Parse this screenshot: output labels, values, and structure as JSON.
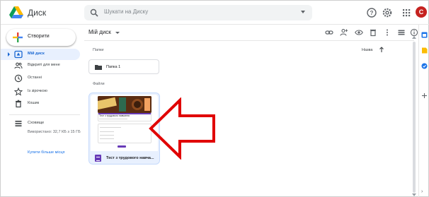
{
  "app": {
    "title": "Диск",
    "logo_icon": "google-drive-logo",
    "colors": {
      "accent": "#1a73e8",
      "active_bg": "#e8f0fe",
      "avatar": "#c5221f",
      "annotation": "#e00000"
    }
  },
  "search": {
    "placeholder": "Шукати на Диску",
    "icon": "search-icon"
  },
  "header": {
    "icons": [
      "support-icon",
      "settings-icon",
      "apps-grid-icon"
    ],
    "avatar_letter": "C"
  },
  "sidebar": {
    "create_label": "Створити",
    "items": [
      {
        "label": "Мій диск",
        "icon": "my-drive-icon",
        "active": true
      },
      {
        "label": "Відкриті для мене",
        "icon": "shared-people-icon",
        "active": false
      },
      {
        "label": "Останні",
        "icon": "clock-icon",
        "active": false
      },
      {
        "label": "Із зірочкою",
        "icon": "star-icon",
        "active": false
      },
      {
        "label": "Кошик",
        "icon": "trash-icon",
        "active": false
      }
    ],
    "storage": {
      "label": "Сховище",
      "icon": "storage-icon",
      "usage": "Використано: 32,7 КБ з 15 ГБ"
    },
    "buy_storage": "Купити більше місця"
  },
  "main": {
    "breadcrumb": "Мій диск",
    "toolbar_icons": [
      "link-icon",
      "add-person-icon",
      "preview-eye-icon",
      "delete-icon",
      "more-vert-icon",
      "list-view-icon",
      "info-icon"
    ],
    "folders_label": "Папки",
    "files_label": "Файли",
    "sort": {
      "label": "Назва",
      "direction": "up-arrow-icon"
    },
    "folders": [
      {
        "name": "Папка 1"
      }
    ],
    "files": [
      {
        "name": "Тест з трудового навча...",
        "type_icon": "google-forms-icon",
        "preview_title": "Тест з трудового навчання"
      }
    ]
  },
  "right_rail": {
    "icons": [
      "calendar-icon",
      "keep-icon",
      "tasks-icon",
      "add-addon-icon"
    ]
  }
}
